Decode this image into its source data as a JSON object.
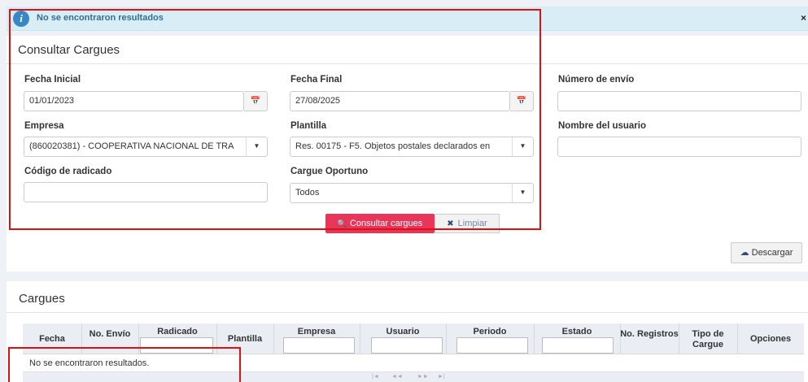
{
  "alert": {
    "message": "No se encontraron resultados",
    "info_glyph": "i",
    "close": "×"
  },
  "consultar": {
    "title": "Consultar Cargues",
    "fecha_inicial": {
      "label": "Fecha Inicial",
      "value": "01/01/2023"
    },
    "fecha_final": {
      "label": "Fecha Final",
      "value": "27/08/2025"
    },
    "numero_envio": {
      "label": "Número de envío",
      "value": ""
    },
    "empresa": {
      "label": "Empresa",
      "value": "(860020381) - COOPERATIVA NACIONAL DE TRA"
    },
    "plantilla": {
      "label": "Plantilla",
      "value": "Res. 00175 - F5. Objetos postales declarados en"
    },
    "nombre_usuario": {
      "label": "Nombre del usuario",
      "value": ""
    },
    "codigo_radicado": {
      "label": "Código de radicado",
      "value": ""
    },
    "cargue_oportuno": {
      "label": "Cargue Oportuno",
      "value": "Todos"
    },
    "consultar_button": "Consultar cargues",
    "limpiar_button": "Limpiar",
    "descargar_button": "Descargar",
    "calendar_glyph": "📅",
    "caret_glyph": "▼",
    "search_glyph": "🔍",
    "clear_glyph": "✖",
    "download_glyph": "☁"
  },
  "cargues": {
    "title": "Cargues",
    "columns": {
      "fecha": "Fecha",
      "no_envio": "No. Envío",
      "radicado": "Radicado",
      "plantilla": "Plantilla",
      "empresa": "Empresa",
      "usuario": "Usuario",
      "periodo": "Periodo",
      "estado": "Estado",
      "no_registros": "No. Registros",
      "tipo_cargue": "Tipo de Cargue",
      "opciones": "Opciones"
    },
    "empty_message": "No se encontraron resultados.",
    "pager": {
      "first": "|◄",
      "prev": "◄◄",
      "next": "►►",
      "last": "►|"
    }
  }
}
